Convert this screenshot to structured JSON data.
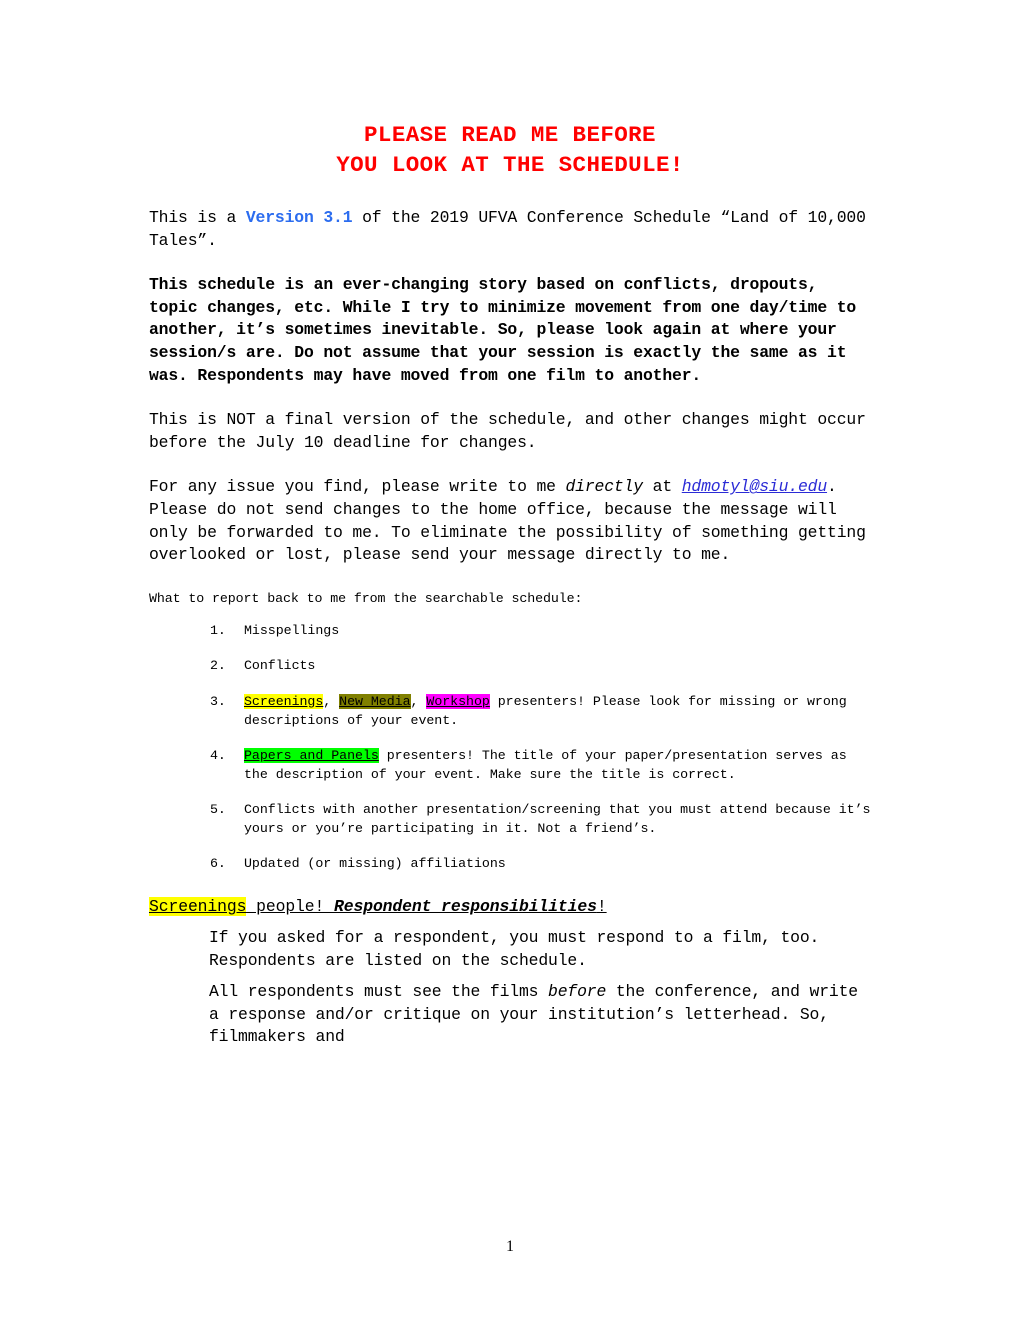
{
  "document": {
    "title_line1": "PLEASE READ ME BEFORE",
    "title_line2": "YOU LOOK AT THE SCHEDULE!",
    "title_color": "#FF0000",
    "page_number": "1"
  },
  "intro": {
    "before_version": "This is a ",
    "version": "Version 3.1",
    "version_color": "#2B6CEF",
    "after_version": " of the 2019 UFVA Conference Schedule “Land of 10,000 Tales”."
  },
  "notice": {
    "text": "This schedule is an ever‑changing story based on conflicts, dropouts, topic changes, etc.  While I try to minimize movement from one day/time to another, it’s sometimes inevitable.  So, please look again at where your session/s are.  Do not assume that your session is exactly the same as it was.  Respondents may have moved from one film to another."
  },
  "not_final": {
    "text": "This is NOT a final version of the schedule, and other changes might occur before the July 10 deadline for changes."
  },
  "contact": {
    "part1": "For any issue you find, please write to me ",
    "emphasis": "directly",
    "part2": " at ",
    "email": "hdmotyl@siu.edu",
    "email_color": "#2B2BD6",
    "part3": ". Please do not send changes to the home office, because the message will only be forwarded to me. To eliminate the possibility of something getting overlooked or lost, please send your message directly to me."
  },
  "report": {
    "heading": "What to report back to me from the searchable schedule:",
    "items": [
      {
        "num": "1.",
        "text": "Misspellings"
      },
      {
        "num": "2.",
        "text": "Conflicts"
      },
      {
        "num": "3.",
        "tag1": "Screenings",
        "tag1_color": "#FFFF00",
        "sep1": ", ",
        "tag2": "New Media",
        "tag2_color": "#808000",
        "sep2": ", ",
        "tag3": "Workshop",
        "tag3_color": "#FF00FF",
        "text": " presenters!  Please look for missing or wrong descriptions of your event."
      },
      {
        "num": "4.",
        "tag1": "Papers and Panels",
        "tag1_color": "#00FF00",
        "text": " presenters! The title of your paper/presentation serves as the description of your event. Make sure the title is correct."
      },
      {
        "num": "5.",
        "text": "Conflicts with another presentation/screening that you must attend because it’s yours or you’re participating in it.  Not a friend’s."
      },
      {
        "num": "6.",
        "text": "Updated (or missing) affiliations"
      }
    ]
  },
  "screenings_section": {
    "tag": "Screenings",
    "tag_color": "#FFFF00",
    "after_tag": " people! ",
    "emphasis": "Respondent responsibilities",
    "exclaim": "!",
    "para1": "If you asked for a respondent, you must respond to a film, too. Respondents are listed on the schedule.",
    "para2_part1": "All respondents must see the films ",
    "para2_emphasis": "before",
    "para2_part2": " the conference, and write a response and/or critique on your institution’s letterhead. So, filmmakers and"
  }
}
